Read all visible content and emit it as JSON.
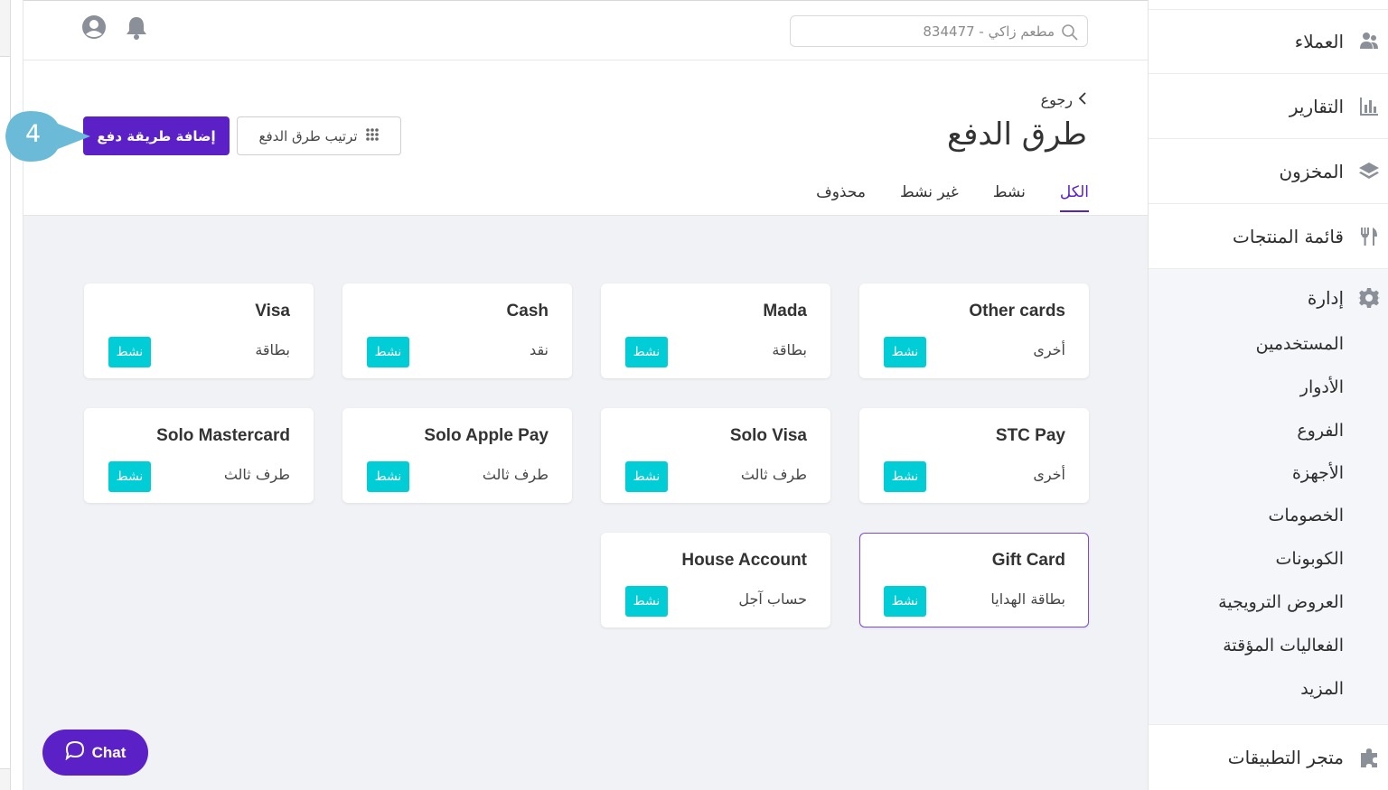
{
  "search": {
    "placeholder": "مطعم زاكي - 834477"
  },
  "header": {
    "back_label": "رجوع",
    "title": "طرق الدفع",
    "add_button": "إضافة طريقة دفع",
    "sort_button": "ترتيب طرق الدفع"
  },
  "tabs": [
    {
      "label": "الكل",
      "active": true
    },
    {
      "label": "نشط",
      "active": false
    },
    {
      "label": "غير نشط",
      "active": false
    },
    {
      "label": "محذوف",
      "active": false
    }
  ],
  "payment_methods": [
    {
      "name": "Other cards",
      "type": "أخرى",
      "status": "نشط"
    },
    {
      "name": "Mada",
      "type": "بطاقة",
      "status": "نشط"
    },
    {
      "name": "Cash",
      "type": "نقد",
      "status": "نشط"
    },
    {
      "name": "Visa",
      "type": "بطاقة",
      "status": "نشط"
    },
    {
      "name": "STC Pay",
      "type": "أخرى",
      "status": "نشط"
    },
    {
      "name": "Solo Visa",
      "type": "طرف ثالث",
      "status": "نشط"
    },
    {
      "name": "Solo Apple Pay",
      "type": "طرف ثالث",
      "status": "نشط"
    },
    {
      "name": "Solo Mastercard",
      "type": "طرف ثالث",
      "status": "نشط"
    },
    {
      "name": "Gift Card",
      "type": "بطاقة الهدايا",
      "status": "نشط",
      "selected": true
    },
    {
      "name": "House Account",
      "type": "حساب آجل",
      "status": "نشط"
    }
  ],
  "sidebar": {
    "items": [
      {
        "label": "العملاء",
        "icon": "customers-icon"
      },
      {
        "label": "التقارير",
        "icon": "reports-icon"
      },
      {
        "label": "المخزون",
        "icon": "inventory-icon"
      },
      {
        "label": "قائمة المنتجات",
        "icon": "menu-icon"
      }
    ],
    "admin": {
      "label": "إدارة",
      "icon": "gear-icon",
      "sub_items": [
        "المستخدمين",
        "الأدوار",
        "الفروع",
        "الأجهزة",
        "الخصومات",
        "الكوبونات",
        "العروض الترويجية",
        "الفعاليات المؤقتة",
        "المزيد"
      ]
    },
    "apps": {
      "label": "متجر التطبيقات",
      "icon": "puzzle-icon"
    }
  },
  "chat": {
    "label": "Chat"
  },
  "callout": {
    "step": "4"
  },
  "colors": {
    "primary": "#5b21c6",
    "badge": "#00cdd5",
    "background": "#f0f2f5"
  }
}
